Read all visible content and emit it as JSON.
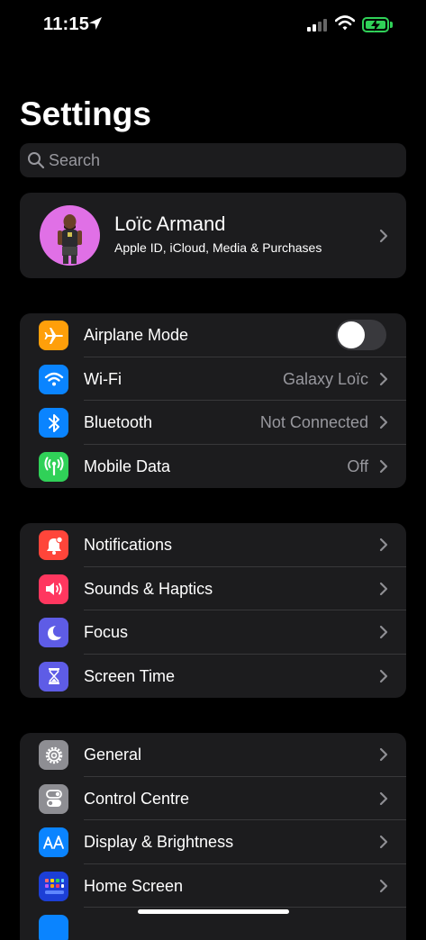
{
  "status_bar": {
    "time": "11:15"
  },
  "title": "Settings",
  "search": {
    "placeholder": "Search"
  },
  "profile": {
    "name": "Loïc Armand",
    "subtitle": "Apple ID, iCloud, Media & Purchases"
  },
  "group1": [
    {
      "label": "Airplane Mode",
      "icon": "airplane-icon",
      "color": "#ff9f0a",
      "toggle_on": false
    },
    {
      "label": "Wi-Fi",
      "value": "Galaxy Loïc",
      "icon": "wifi-icon",
      "color": "#0a84ff"
    },
    {
      "label": "Bluetooth",
      "value": "Not Connected",
      "icon": "bluetooth-icon",
      "color": "#0a84ff"
    },
    {
      "label": "Mobile Data",
      "value": "Off",
      "icon": "antenna-icon",
      "color": "#30d158"
    }
  ],
  "group2": [
    {
      "label": "Notifications",
      "icon": "bell-icon",
      "color": "#ff453a"
    },
    {
      "label": "Sounds & Haptics",
      "icon": "speaker-icon",
      "color": "#ff375f"
    },
    {
      "label": "Focus",
      "icon": "moon-icon",
      "color": "#5e5ce6"
    },
    {
      "label": "Screen Time",
      "icon": "hourglass-icon",
      "color": "#5e5ce6"
    }
  ],
  "group3": [
    {
      "label": "General",
      "icon": "gear-icon",
      "color": "#8e8e93"
    },
    {
      "label": "Control Centre",
      "icon": "switches-icon",
      "color": "#8e8e93"
    },
    {
      "label": "Display & Brightness",
      "icon": "text-size-icon",
      "color": "#0a84ff"
    },
    {
      "label": "Home Screen",
      "icon": "app-grid-icon",
      "color": "#0a84ff"
    }
  ]
}
